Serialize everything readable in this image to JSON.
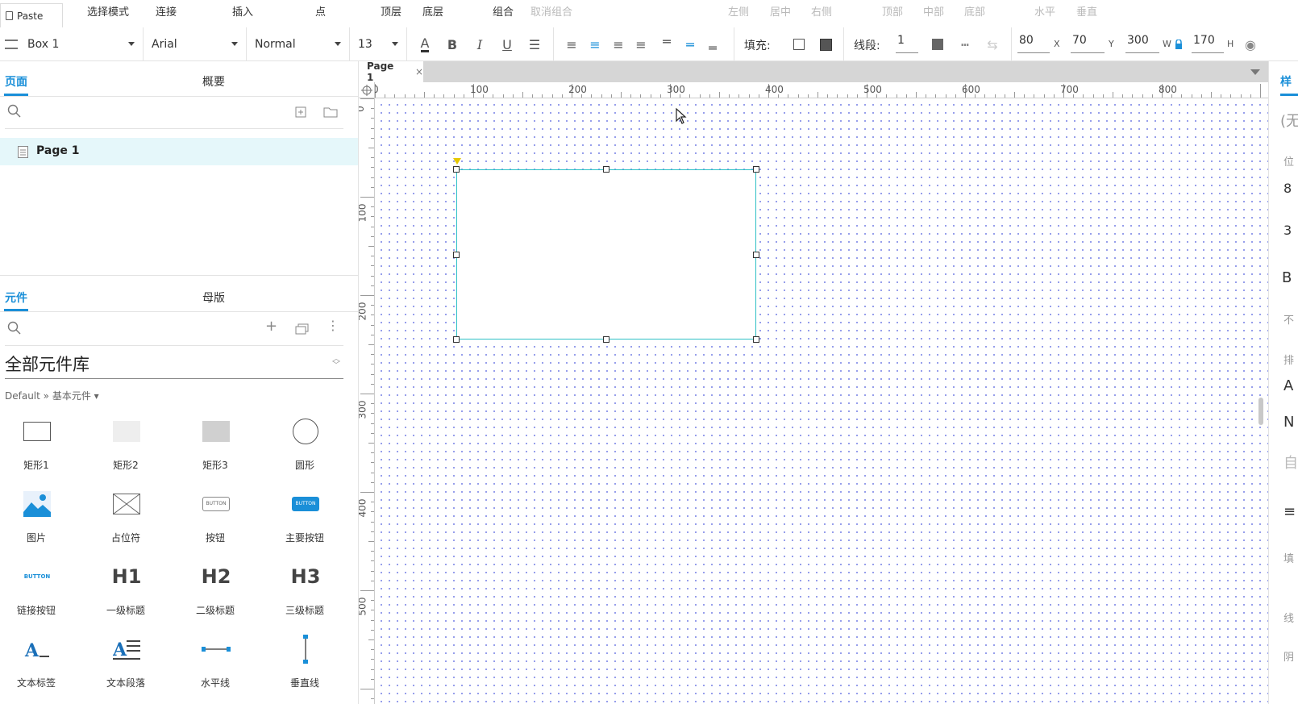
{
  "menu": {
    "paste": "Paste",
    "items": [
      "选择模式",
      "连接",
      "插入",
      "点",
      "顶层",
      "底层",
      "组合"
    ],
    "disabled": [
      "取消组合",
      "左侧",
      "居中",
      "右侧",
      "顶部",
      "中部",
      "底部",
      "水平",
      "垂直"
    ]
  },
  "format": {
    "style_name": "Box 1",
    "font": "Arial",
    "weight": "Normal",
    "size": "13",
    "fill_label": "填充:",
    "stroke_label": "线段:",
    "stroke_value": "1",
    "x": "80",
    "x_label": "X",
    "y": "70",
    "y_label": "Y",
    "w": "300",
    "w_label": "W",
    "h": "170",
    "h_label": "H"
  },
  "left": {
    "tab_pages": "页面",
    "tab_outline": "概要",
    "page_item": "Page 1",
    "tab_widgets": "元件",
    "tab_masters": "母版",
    "library": "全部元件库",
    "breadcrumb": "Default » 基本元件 ▾",
    "widgets": [
      {
        "label": "矩形1",
        "icon": "rectangle1-icon"
      },
      {
        "label": "矩形2",
        "icon": "rectangle2-icon"
      },
      {
        "label": "矩形3",
        "icon": "rectangle3-icon"
      },
      {
        "label": "圆形",
        "icon": "circle-icon"
      },
      {
        "label": "图片",
        "icon": "image-icon"
      },
      {
        "label": "占位符",
        "icon": "placeholder-icon"
      },
      {
        "label": "按钮",
        "icon": "button-icon"
      },
      {
        "label": "主要按钮",
        "icon": "primary-button-icon"
      },
      {
        "label": "链接按钮",
        "icon": "link-button-icon"
      },
      {
        "label": "一级标题",
        "icon": "h1-icon"
      },
      {
        "label": "二级标题",
        "icon": "h2-icon"
      },
      {
        "label": "三级标题",
        "icon": "h3-icon"
      },
      {
        "label": "文本标签",
        "icon": "text-label-icon"
      },
      {
        "label": "文本段落",
        "icon": "text-paragraph-icon"
      },
      {
        "label": "水平线",
        "icon": "horizontal-line-icon"
      },
      {
        "label": "垂直线",
        "icon": "vertical-line-icon"
      }
    ],
    "button_text": "BUTTON",
    "h1": "H1",
    "h2": "H2",
    "h3": "H3"
  },
  "canvas": {
    "tab": "Page 1",
    "hruler": [
      "0",
      "100",
      "200",
      "300",
      "400",
      "500",
      "600",
      "700",
      "800"
    ],
    "vruler": [
      "0",
      "100",
      "200",
      "300",
      "400",
      "500"
    ]
  },
  "right": {
    "tab": "样",
    "fragments": [
      "(无",
      "位",
      "8",
      "3",
      "B",
      "不",
      "排",
      "A",
      "N",
      "自",
      "≡",
      "填",
      "线",
      "阴"
    ]
  },
  "colors": {
    "accent": "#1a8fd8",
    "selection": "#2ec0c6",
    "grid_dot": "#7c86e6"
  }
}
